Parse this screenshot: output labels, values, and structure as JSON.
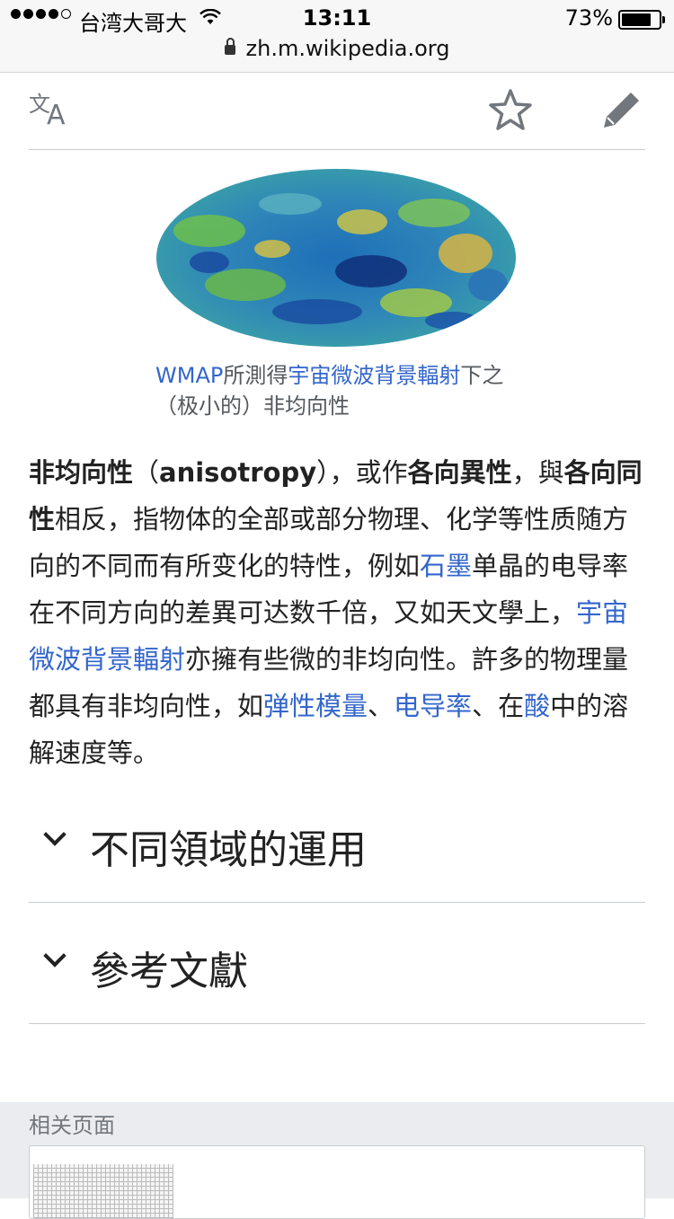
{
  "status_bar": {
    "carrier": "台湾大哥大",
    "time": "13:11",
    "battery": "73%",
    "battery_level": 0.73,
    "url": "zh.m.wikipedia.org"
  },
  "toolbar": {
    "language_icon": "translate-icon",
    "star_icon": "star-icon",
    "edit_icon": "pencil-icon"
  },
  "figure": {
    "caption_parts": [
      {
        "text": "WMAP",
        "link": true
      },
      {
        "text": "所測得",
        "link": false
      },
      {
        "text": "宇宙微波背景輻射",
        "link": true
      },
      {
        "text": "下之（极小的）非均向性",
        "link": false
      }
    ]
  },
  "article": {
    "segments": [
      {
        "text": "非均向性",
        "style": "bold"
      },
      {
        "text": "（",
        "style": "plain"
      },
      {
        "text": "anisotropy",
        "style": "bold"
      },
      {
        "text": "），或作",
        "style": "plain"
      },
      {
        "text": "各向異性",
        "style": "bold"
      },
      {
        "text": "，與",
        "style": "plain"
      },
      {
        "text": "各向同性",
        "style": "boldlink"
      },
      {
        "text": "相反，指物体的全部或部分物理、化学等性质随方向的不同而有所变化的特性，例如",
        "style": "plain"
      },
      {
        "text": "石墨",
        "style": "link"
      },
      {
        "text": "单晶的电导率在不同方向的差異可达数千倍，又如天文學上，",
        "style": "plain"
      },
      {
        "text": "宇宙微波背景輻射",
        "style": "link"
      },
      {
        "text": "亦擁有些微的非均向性。許多的物理量都具有非均向性，如",
        "style": "plain"
      },
      {
        "text": "弹性模量",
        "style": "link"
      },
      {
        "text": "、",
        "style": "plain"
      },
      {
        "text": "电导率",
        "style": "link"
      },
      {
        "text": "、在",
        "style": "plain"
      },
      {
        "text": "酸",
        "style": "link"
      },
      {
        "text": "中的溶解速度等。",
        "style": "plain"
      }
    ]
  },
  "sections": [
    {
      "title": "不同領域的運用"
    },
    {
      "title": "參考文獻"
    }
  ],
  "related": {
    "label": "相关页面"
  },
  "colors": {
    "link": "#3366cc",
    "text": "#222222",
    "muted": "#72777d",
    "divider": "#c8ccd1",
    "related_bg": "#eaecf0"
  }
}
